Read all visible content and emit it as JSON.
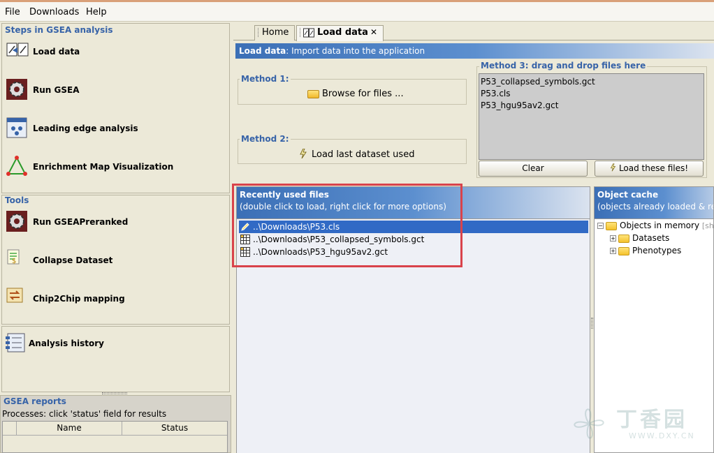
{
  "menu": [
    "File",
    "Downloads",
    "Help"
  ],
  "steps": {
    "title": "Steps in GSEA analysis",
    "items": [
      {
        "label": "Load data",
        "icon": "load-data-icon"
      },
      {
        "label": "Run GSEA",
        "icon": "gear-icon"
      },
      {
        "label": "Leading edge analysis",
        "icon": "leading-edge-icon"
      },
      {
        "label": "Enrichment Map Visualization",
        "icon": "enrichment-map-icon"
      }
    ]
  },
  "tools": {
    "title": "Tools",
    "items": [
      {
        "label": "Run GSEAPreranked",
        "icon": "gear-icon"
      },
      {
        "label": "Collapse Dataset",
        "icon": "collapse-icon"
      },
      {
        "label": "Chip2Chip mapping",
        "icon": "chip-icon"
      }
    ]
  },
  "history": {
    "label": "Analysis history"
  },
  "reports": {
    "title": "GSEA reports",
    "subtitle": "Processes: click 'status' field for results",
    "columns": [
      "Name",
      "Status"
    ]
  },
  "tabs": [
    {
      "label": "Home"
    },
    {
      "label": "Load data",
      "close": "✕"
    }
  ],
  "load_header": {
    "title": "Load data",
    "desc": ": Import data into the application"
  },
  "method1": {
    "label": "Method 1:",
    "button": "Browse for files ..."
  },
  "method2": {
    "label": "Method 2:",
    "button": "Load last dataset used"
  },
  "method3": {
    "label": "Method 3: drag and drop files here",
    "files": [
      "P53_collapsed_symbols.gct",
      "P53.cls",
      "P53_hgu95av2.gct"
    ],
    "clear": "Clear",
    "load": "Load these files!"
  },
  "recent": {
    "title": "Recently used files",
    "subtitle": "(double click to load, right click for more options)",
    "files": [
      "..\\Downloads\\P53.cls",
      "..\\Downloads\\P53_collapsed_symbols.gct",
      "..\\Downloads\\P53_hgu95av2.gct"
    ]
  },
  "cache": {
    "title": "Object cache",
    "subtitle": "(objects already loaded & re",
    "root": "Objects in memory",
    "root_suffix": "[shi",
    "children": [
      "Datasets",
      "Phenotypes"
    ]
  },
  "watermark": {
    "brand": "丁香园",
    "url": "WWW.DXY.CN"
  },
  "colors": {
    "accent": "#3763a8",
    "highlight_box": "#d9434b",
    "selected_row": "#316ac5"
  }
}
